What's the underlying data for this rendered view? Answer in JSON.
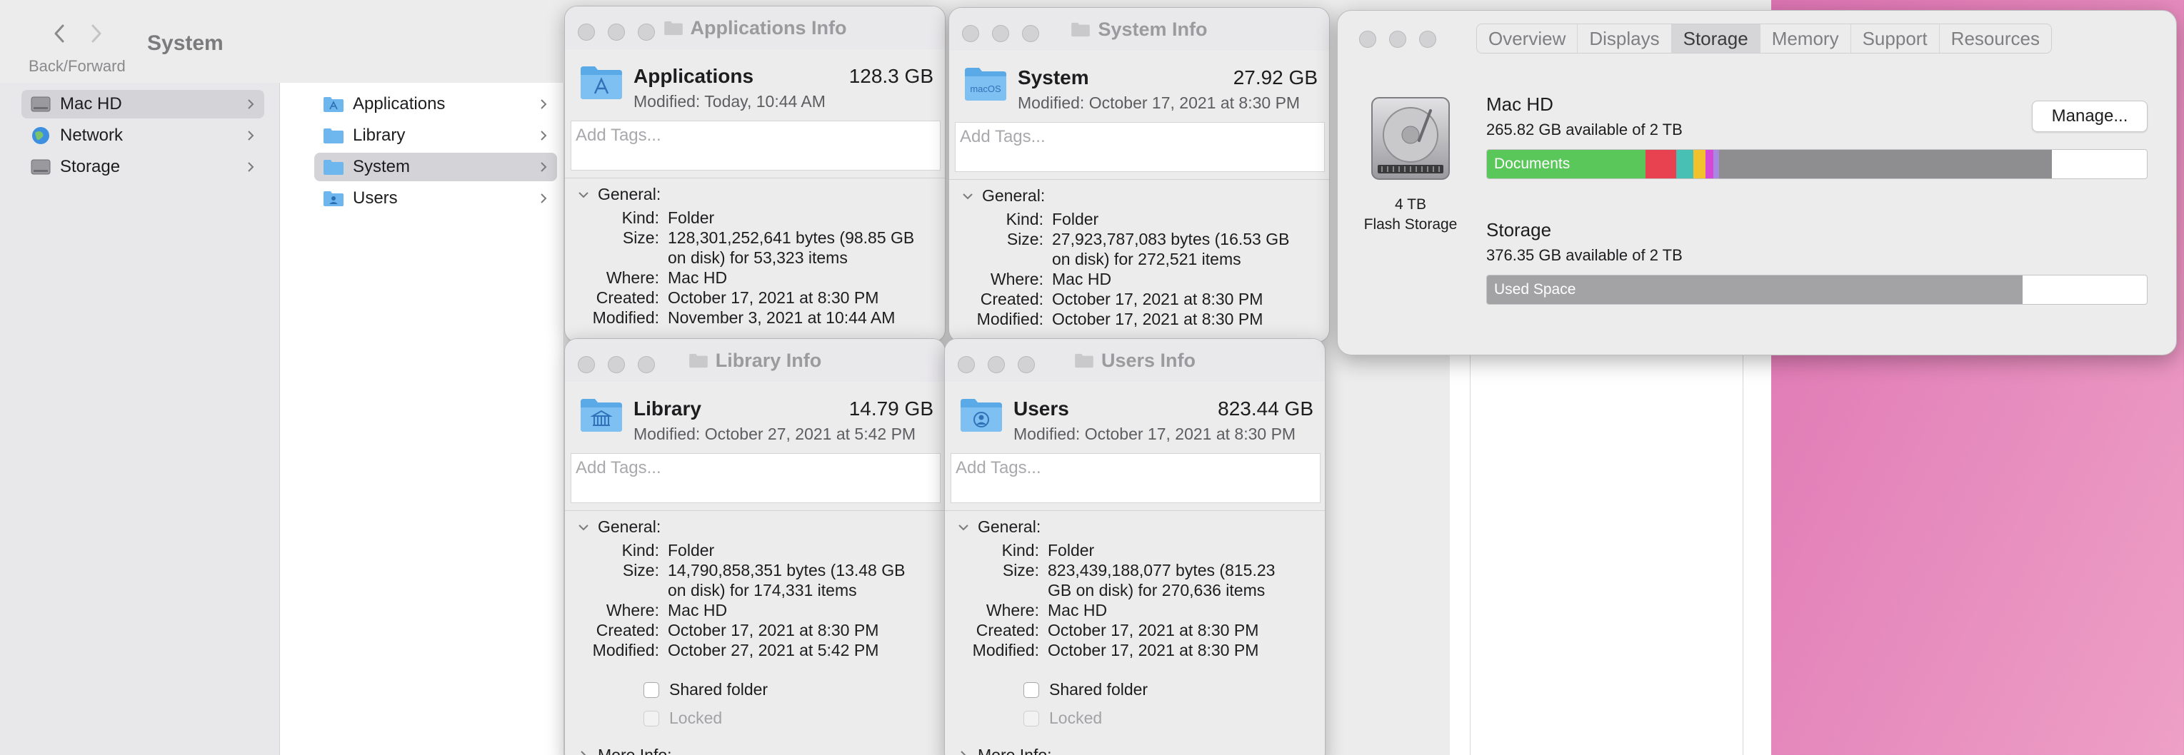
{
  "finder": {
    "title": "System",
    "back_forward_label": "Back/Forward",
    "sidebar": [
      {
        "label": "Mac HD",
        "icon": "drive-icon",
        "selected": true
      },
      {
        "label": "Network",
        "icon": "globe-icon",
        "selected": false
      },
      {
        "label": "Storage",
        "icon": "drive-icon",
        "selected": false
      }
    ],
    "column2": [
      {
        "label": "Applications",
        "icon": "applications-folder-icon",
        "selected": false
      },
      {
        "label": "Library",
        "icon": "folder-icon",
        "selected": false
      },
      {
        "label": "System",
        "icon": "folder-icon",
        "selected": true
      },
      {
        "label": "Users",
        "icon": "users-folder-icon",
        "selected": false
      }
    ]
  },
  "info_windows": [
    {
      "window_title": "Applications Info",
      "name": "Applications",
      "size": "128.3 GB",
      "modified_line": "Modified: Today, 10:44 AM",
      "tags_placeholder": "Add Tags...",
      "general_label": "General:",
      "kind": "Folder",
      "size_detail_1": "128,301,252,641 bytes (98.85 GB",
      "size_detail_2": "on disk) for 53,323 items",
      "where": "Mac HD",
      "created": "October 17, 2021 at 8:30 PM",
      "modified": "November 3, 2021 at 10:44 AM"
    },
    {
      "window_title": "System Info",
      "name": "System",
      "size": "27.92 GB",
      "icon_label": "macOS",
      "modified_line": "Modified: October 17, 2021 at 8:30 PM",
      "tags_placeholder": "Add Tags...",
      "general_label": "General:",
      "kind": "Folder",
      "size_detail_1": "27,923,787,083 bytes (16.53 GB",
      "size_detail_2": "on disk) for 272,521 items",
      "where": "Mac HD",
      "created": "October 17, 2021 at 8:30 PM",
      "modified": "October 17, 2021 at 8:30 PM"
    },
    {
      "window_title": "Library Info",
      "name": "Library",
      "size": "14.79 GB",
      "modified_line": "Modified: October 27, 2021 at 5:42 PM",
      "tags_placeholder": "Add Tags...",
      "general_label": "General:",
      "kind": "Folder",
      "size_detail_1": "14,790,858,351 bytes (13.48 GB",
      "size_detail_2": "on disk) for 174,331 items",
      "where": "Mac HD",
      "created": "October 17, 2021 at 8:30 PM",
      "modified": "October 27, 2021 at 5:42 PM",
      "shared_folder": "Shared folder",
      "locked": "Locked",
      "more_info": "More Info:"
    },
    {
      "window_title": "Users Info",
      "name": "Users",
      "size": "823.44 GB",
      "modified_line": "Modified: October 17, 2021 at 8:30 PM",
      "tags_placeholder": "Add Tags...",
      "general_label": "General:",
      "kind": "Folder",
      "size_detail_1": "823,439,188,077 bytes (815.23",
      "size_detail_2": "GB on disk) for 270,636 items",
      "where": "Mac HD",
      "created": "October 17, 2021 at 8:30 PM",
      "modified": "October 17, 2021 at 8:30 PM",
      "shared_folder": "Shared folder",
      "locked": "Locked",
      "more_info": "More Info:"
    }
  ],
  "labels": {
    "kind": "Kind:",
    "size": "Size:",
    "where": "Where:",
    "created": "Created:",
    "modified": "Modified:"
  },
  "about": {
    "tabs": [
      "Overview",
      "Displays",
      "Storage",
      "Memory",
      "Support",
      "Resources"
    ],
    "active_tab": "Storage",
    "disk_caption_1": "4 TB",
    "disk_caption_2": "Flash Storage",
    "manage_label": "Manage...",
    "volumes": [
      {
        "name": "Mac HD",
        "available": "265.82 GB available of 2 TB",
        "segments": [
          {
            "label": "Documents",
            "fraction": 0.24,
            "color": "#5ac75a"
          },
          {
            "label": "",
            "fraction": 0.047,
            "color": "#e8414f"
          },
          {
            "label": "",
            "fraction": 0.026,
            "color": "#48c1b4"
          },
          {
            "label": "",
            "fraction": 0.018,
            "color": "#f2c12e"
          },
          {
            "label": "",
            "fraction": 0.012,
            "color": "#d547d6"
          },
          {
            "label": "",
            "fraction": 0.009,
            "color": "#a78ae0"
          },
          {
            "label": "",
            "fraction": 0.504,
            "color": "#8e8e91"
          }
        ]
      },
      {
        "name": "Storage",
        "available": "376.35 GB available of 2 TB",
        "segments": [
          {
            "label": "Used Space",
            "fraction": 0.812,
            "color": "#a3a3a6"
          }
        ]
      }
    ]
  }
}
